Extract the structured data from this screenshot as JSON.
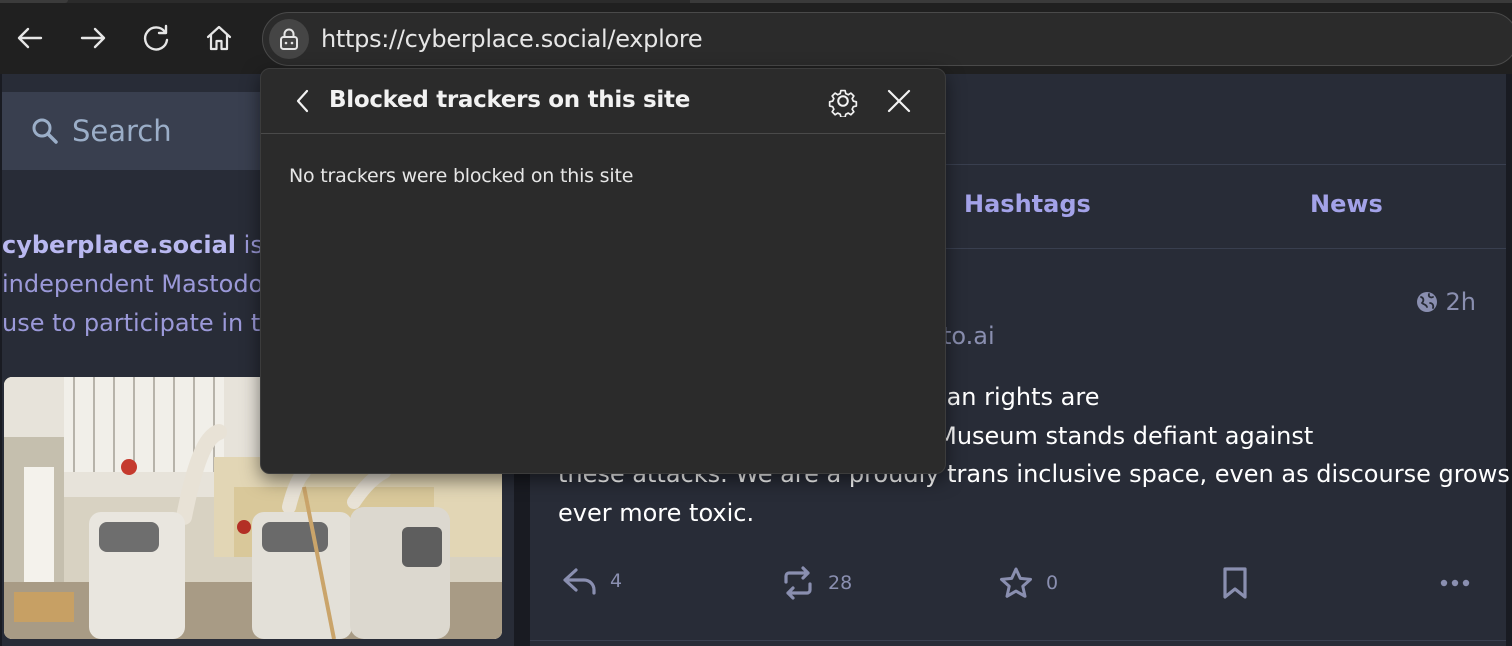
{
  "browser": {
    "url": "https://cyberplace.social/explore",
    "nav_icons": [
      "back-icon",
      "forward-icon",
      "refresh-icon",
      "home-icon",
      "lock-icon"
    ]
  },
  "popup": {
    "title": "Blocked trackers on this site",
    "message": "No trackers were blocked on this site",
    "icons": [
      "chevron-left-icon",
      "gear-icon",
      "close-icon"
    ]
  },
  "sidebar": {
    "search_placeholder": "Search",
    "about_site": "cyberplace.social",
    "about_line1_rest": " is o",
    "about_line2": "independent Mastodo",
    "about_line3": "use to participate in th"
  },
  "explore": {
    "tabs": [
      {
        "label": "Hashtags"
      },
      {
        "label": "News"
      }
    ]
  },
  "post": {
    "time": "2h",
    "handle_fragment": "to.ai",
    "body": "nce. Trans people and their human rights are\n                                   e Vagina Museum stands defiant against\nthese attacks. We are a proudly trans inclusive space, even as discourse grows\never more toxic.",
    "replies": "4",
    "boosts": "28",
    "favourites": "0"
  },
  "colors": {
    "accent": "#8c8dff",
    "page_bg": "#191b22",
    "column_bg": "#282c37",
    "popup_bg": "#2b2b2b"
  }
}
